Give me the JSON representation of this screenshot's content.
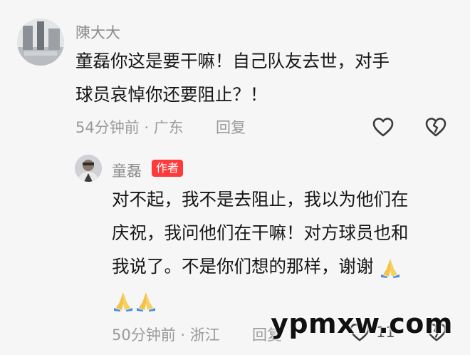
{
  "comment": {
    "username": "陳大大",
    "text_line1": "童磊你这是要干嘛！自己队友去世，对手",
    "text_line2": "球员哀悼你还要阻止？！",
    "time": "54分钟前",
    "separator": " · ",
    "location": "广东",
    "reply_label": "回复",
    "like_icon": "heart-icon",
    "dislike_icon": "broken-heart-icon"
  },
  "reply": {
    "username": "童磊",
    "badge": "作者",
    "text_line1": "对不起，我不是去阻止，我以为他们在",
    "text_line2": "庆祝，我问他们在干嘛！对方球员也和",
    "text_line3": "我说了。不是你们想的那样，谢谢",
    "emoji_icon": "praying-hands-emoji",
    "time": "50分钟前",
    "separator": " · ",
    "location": "浙江",
    "reply_label": "回复",
    "like_count": "11",
    "like_icon": "heart-icon",
    "dislike_icon": "broken-heart-icon"
  },
  "watermark": "ypmxw.com",
  "colors": {
    "background": "#f6f6f6",
    "text": "#161616",
    "meta": "#9a9a9a",
    "badge": "#ff3a3a"
  }
}
